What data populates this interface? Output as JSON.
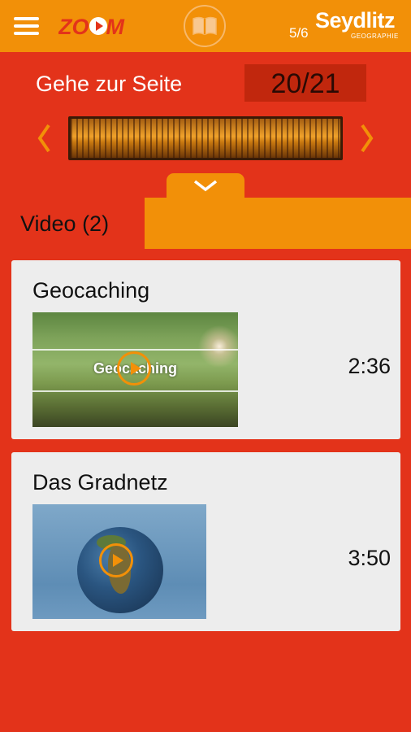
{
  "header": {
    "logo_text": "ZOOM",
    "grade": "5/6",
    "brand": "Seydlitz",
    "brand_sub": "GEOGRAPHIE",
    "icons": [
      "menu-icon",
      "book-icon"
    ]
  },
  "navigator": {
    "label": "Gehe zur Seite",
    "page": "20/21",
    "icons": [
      "chevron-left-icon",
      "chevron-right-icon",
      "chevron-down-icon"
    ]
  },
  "tabs": [
    {
      "label": "Video (2)",
      "active": true
    }
  ],
  "videos": [
    {
      "title": "Geocaching",
      "thumb_text": "Geocaching",
      "duration": "2:36"
    },
    {
      "title": "Das Gradnetz",
      "duration": "3:50"
    }
  ],
  "colors": {
    "red": "#e3331a",
    "orange": "#f29008",
    "card": "#ededed"
  }
}
